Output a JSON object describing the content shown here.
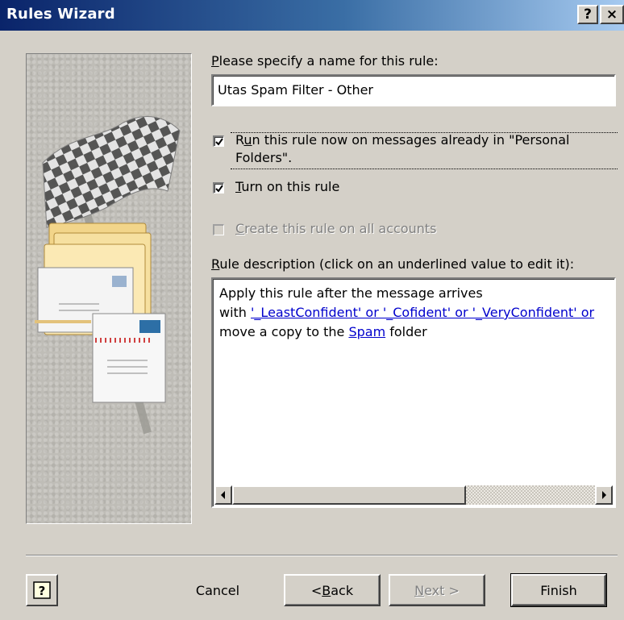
{
  "window": {
    "title": "Rules Wizard",
    "help_caption": "?",
    "close_caption": "×"
  },
  "name_field": {
    "label_pre": "",
    "label_mnemonic": "P",
    "label_post": "lease specify a name for this rule:",
    "value": "Utas Spam Filter - Other"
  },
  "options": {
    "run_now": {
      "label_pre": "R",
      "label_mnemonic": "u",
      "label_line1_post": "n this rule now on messages already in \"Personal",
      "label_line2": "Folders\".",
      "checked": true
    },
    "turn_on": {
      "label_mnemonic": "T",
      "label_post": "urn on this rule",
      "checked": true
    },
    "all_accounts": {
      "label_mnemonic": "C",
      "label_post": "reate this rule on all accounts",
      "checked": false,
      "enabled": false
    }
  },
  "description": {
    "label_mnemonic": "R",
    "label_post": "ule description (click on an underlined value to edit it):",
    "line1": "Apply this rule after the message arrives",
    "line2_prefix": "with ",
    "line2_link": "'_LeastConfident' or '_Cofident' or '_VeryConfident' or",
    "line3_prefix": "move a copy to the ",
    "line3_link": "Spam",
    "line3_suffix": " folder"
  },
  "buttons": {
    "help_icon": "help-question-icon",
    "cancel": "Cancel",
    "back_pre": "< ",
    "back_mnemonic": "B",
    "back_post": "ack",
    "next_mnemonic": "N",
    "next_post": "ext >",
    "finish": "Finish"
  },
  "colors": {
    "titlebar_start": "#0a246a",
    "titlebar_end": "#a6caf0",
    "face": "#d4d0c8",
    "link": "#0000cc"
  }
}
